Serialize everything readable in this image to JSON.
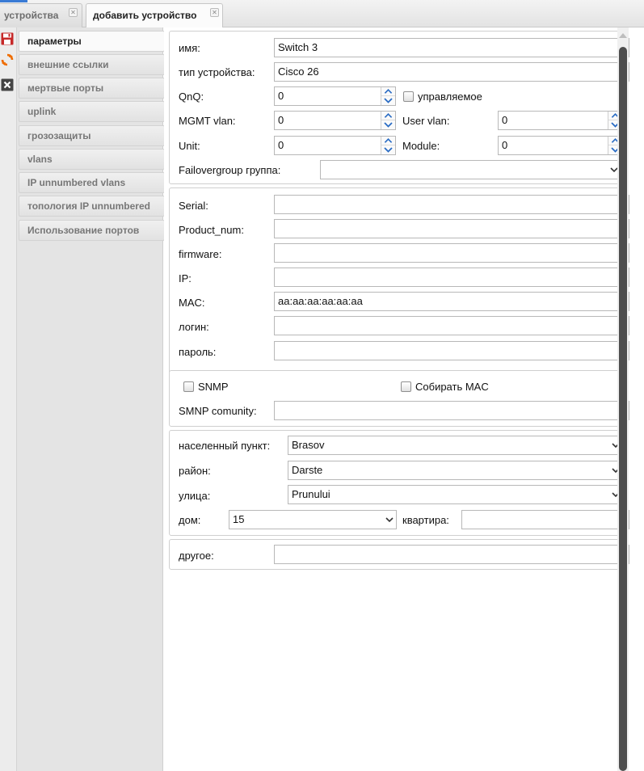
{
  "tabs": [
    {
      "label": "устройства",
      "active": false
    },
    {
      "label": "добавить устройство",
      "active": true
    }
  ],
  "sidebar": {
    "items": [
      {
        "label": "параметры",
        "active": true
      },
      {
        "label": "внешние ссылки"
      },
      {
        "label": "мертвые порты"
      },
      {
        "label": "uplink"
      },
      {
        "label": "грозозащиты"
      },
      {
        "label": "vlans"
      },
      {
        "label": "IP unnumbered vlans"
      },
      {
        "label": "топология IP unnumbered"
      },
      {
        "label": "Использование портов"
      }
    ]
  },
  "form": {
    "name_label": "имя:",
    "name_value": "Switch 3",
    "type_label": "тип устройства:",
    "type_value": "Cisco 26",
    "qnq_label": "QnQ:",
    "qnq_value": "0",
    "managed_label": "управляемое",
    "mgmt_vlan_label": "MGMT vlan:",
    "mgmt_vlan_value": "0",
    "user_vlan_label": "User vlan:",
    "user_vlan_value": "0",
    "unit_label": "Unit:",
    "unit_value": "0",
    "module_label": "Module:",
    "module_value": "0",
    "failover_label": "Failovergroup группа:",
    "failover_value": "",
    "serial_label": "Serial:",
    "product_label": "Product_num:",
    "firmware_label": "firmware:",
    "ip_label": "IP:",
    "mac_label": "MAC:",
    "mac_value": "aa:aa:aa:aa:aa:aa",
    "login_label": "логин:",
    "password_label": "пароль:",
    "snmp_label": "SNMP",
    "collect_mac_label": "Собирать MAC",
    "snmp_community_label": "SMNP comunity:",
    "locality_label": "населенный пункт:",
    "locality_value": "Brasov",
    "district_label": "район:",
    "district_value": "Darste",
    "street_label": "улица:",
    "street_value": "Prunului",
    "house_label": "дом:",
    "house_value": "15",
    "apartment_label": "квартира:",
    "other_label": "другое:"
  },
  "colors": {
    "accent": "#3a7bd5",
    "save_icon": "#c62828",
    "refresh_icon": "#ef6c00",
    "close_icon": "#444444",
    "spinner_arrow": "#2a6cc4"
  }
}
